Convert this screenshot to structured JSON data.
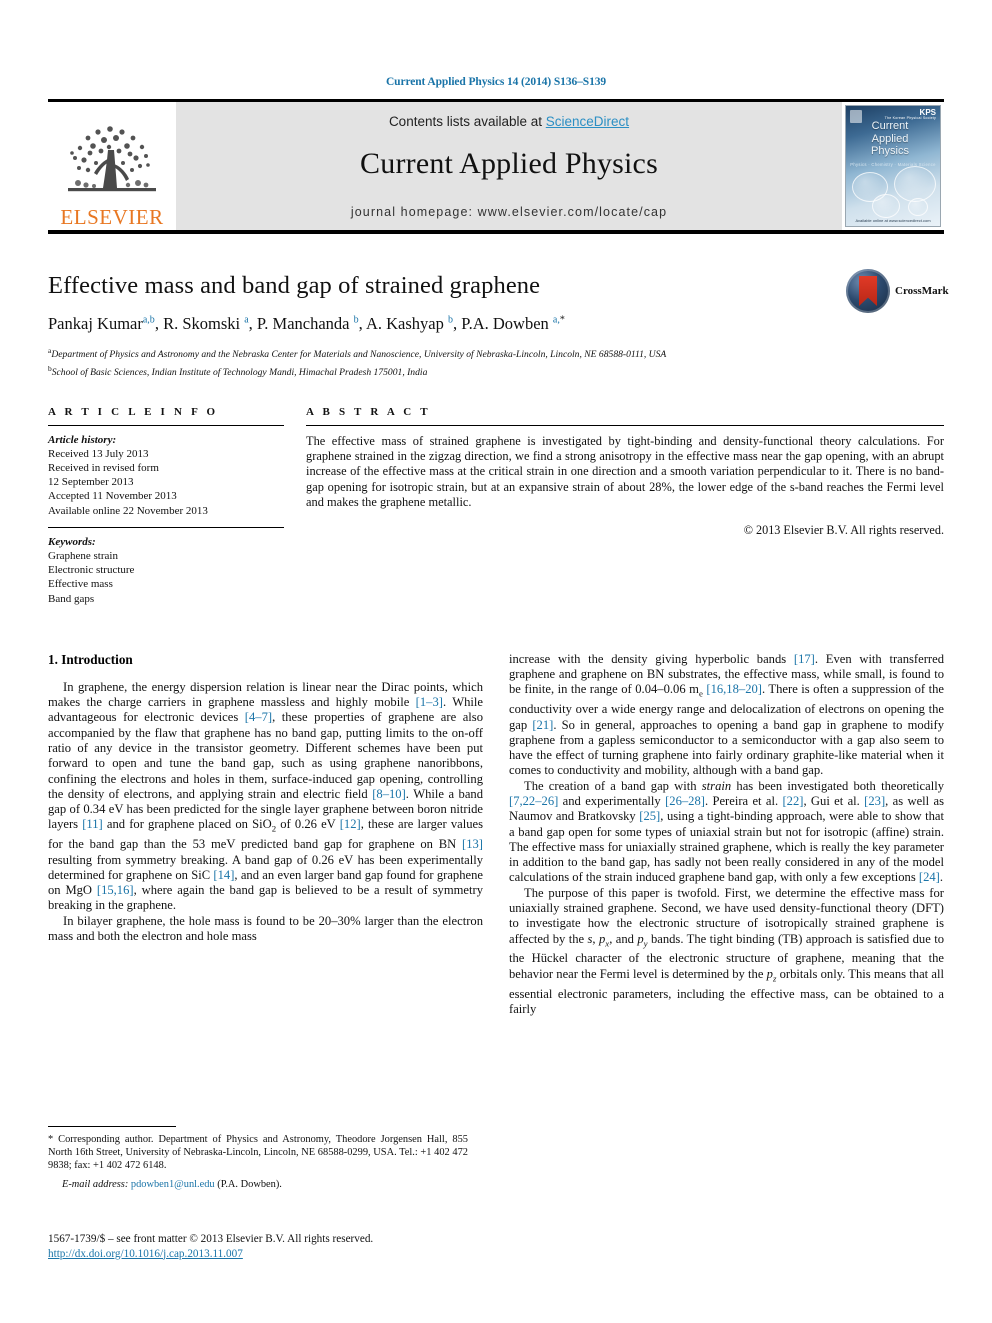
{
  "running_head": "Current Applied Physics 14 (2014) S136–S139",
  "masthead": {
    "publisher_name": "ELSEVIER",
    "contents_prefix": "Contents lists available at ",
    "sciencedirect": "ScienceDirect",
    "journal_title": "Current Applied Physics",
    "homepage": "journal homepage: www.elsevier.com/locate/cap",
    "cover": {
      "title_line1": "Current",
      "title_line2": "Applied",
      "title_line3": "Physics",
      "subtitle": "Physics · Chemistry · Materials Science",
      "kps": "KPS",
      "kps_sub": "The Korean Physical Society",
      "footer": "Available online at www.sciencedirect.com"
    },
    "link_color": "#2b8fc4"
  },
  "article": {
    "title": "Effective mass and band gap of strained graphene",
    "authors_html": "Pankaj Kumar<sup>a,b</sup>, R. Skomski <sup>a</sup>, P. Manchanda <sup>b</sup>, A. Kashyap <sup>b</sup>, P.A. Dowben <sup>a,</sup><sup class=\"star\">*</sup>",
    "affiliation_a": "Department of Physics and Astronomy and the Nebraska Center for Materials and Nanoscience, University of Nebraska-Lincoln, Lincoln, NE 68588-0111, USA",
    "affiliation_b": "School of Basic Sciences, Indian Institute of Technology Mandi, Himachal Pradesh 175001, India",
    "crossmark_label": "CrossMark"
  },
  "article_info": {
    "heading": "A R T I C L E   I N F O",
    "history_label": "Article history:",
    "history": [
      "Received 13 July 2013",
      "Received in revised form",
      "12 September 2013",
      "Accepted 11 November 2013",
      "Available online 22 November 2013"
    ],
    "keywords_label": "Keywords:",
    "keywords": [
      "Graphene strain",
      "Electronic structure",
      "Effective mass",
      "Band gaps"
    ]
  },
  "abstract": {
    "heading": "A B S T R A C T",
    "text": "The effective mass of strained graphene is investigated by tight-binding and density-functional theory calculations. For graphene strained in the zigzag direction, we find a strong anisotropy in the effective mass near the gap opening, with an abrupt increase of the effective mass at the critical strain in one direction and a smooth variation perpendicular to it. There is no band-gap opening for isotropic strain, but at an expansive strain of about 28%, the lower edge of the s-band reaches the Fermi level and makes the graphene metallic.",
    "copyright": "© 2013 Elsevier B.V. All rights reserved."
  },
  "body": {
    "section_title": "1. Introduction",
    "left_paragraphs": [
      "In graphene, the energy dispersion relation is linear near the Dirac points, which makes the charge carriers in graphene massless and highly mobile <a class=\"ref\" href=\"#\">[1–3]</a>. While advantageous for electronic devices <a class=\"ref\" href=\"#\">[4–7]</a>, these properties of graphene are also accompanied by the flaw that graphene has no band gap, putting limits to the on-off ratio of any device in the transistor geometry. Different schemes have been put forward to open and tune the band gap, such as using graphene nanoribbons, confining the electrons and holes in them, surface-induced gap opening, controlling the density of electrons, and applying strain and electric field <a class=\"ref\" href=\"#\">[8–10]</a>. While a band gap of 0.34 eV has been predicted for the single layer graphene between boron nitride layers <a class=\"ref\" href=\"#\">[11]</a> and for graphene placed on SiO<sub>2</sub> of 0.26 eV <a class=\"ref\" href=\"#\">[12]</a>, these are larger values for the band gap than the 53 meV predicted band gap for graphene on BN <a class=\"ref\" href=\"#\">[13]</a> resulting from symmetry breaking. A band gap of 0.26 eV has been experimentally determined for graphene on SiC <a class=\"ref\" href=\"#\">[14]</a>, and an even larger band gap found for graphene on MgO <a class=\"ref\" href=\"#\">[15,16]</a>, where again the band gap is believed to be a result of symmetry breaking in the graphene.",
      "In bilayer graphene, the hole mass is found to be 20–30% larger than the electron mass and both the electron and hole mass"
    ],
    "right_paragraphs": [
      "increase with the density giving hyperbolic bands <a class=\"ref\" href=\"#\">[17]</a>. Even with transferred graphene and graphene on BN substrates, the effective mass, while small, is found to be finite, in the range of 0.04–0.06 m<sub>e</sub> <a class=\"ref\" href=\"#\">[16,18–20]</a>. There is often a suppression of the conductivity over a wide energy range and delocalization of electrons on opening the gap <a class=\"ref\" href=\"#\">[21]</a>. So in general, approaches to opening a band gap in graphene to modify graphene from a gapless semiconductor to a semiconductor with a gap also seem to have the effect of turning graphene into fairly ordinary graphite-like material when it comes to conductivity and mobility, although with a band gap.",
      "The creation of a band gap with <i class=\"mi\">strain</i> has been investigated both theoretically <a class=\"ref\" href=\"#\">[7,22–26]</a> and experimentally <a class=\"ref\" href=\"#\">[26–28]</a>. Pereira et al. <a class=\"ref\" href=\"#\">[22]</a>, Gui et al. <a class=\"ref\" href=\"#\">[23]</a>, as well as Naumov and Bratkovsky <a class=\"ref\" href=\"#\">[25]</a>, using a tight-binding approach, were able to show that a band gap open for some types of uniaxial strain but not for isotropic (affine) strain. The effective mass for uniaxially strained graphene, which is really the key parameter in addition to the band gap, has sadly not been really considered in any of the model calculations of the strain induced graphene band gap, with only a few exceptions <a class=\"ref\" href=\"#\">[24]</a>.",
      "The purpose of this paper is twofold. First, we determine the effective mass for uniaxially strained graphene. Second, we have used density-functional theory (DFT) to investigate how the electronic structure of isotropically strained graphene is affected by the <i class=\"mi\">s</i>, <i class=\"mi\">p<sub>x</sub></i>, and <i class=\"mi\">p<sub>y</sub></i> bands. The tight binding (TB) approach is satisfied due to the Hückel character of the electronic structure of graphene, meaning that the behavior near the Fermi level is determined by the <i class=\"mi\">p<sub>z</sub></i> orbitals only. This means that all essential electronic parameters, including the effective mass, can be obtained to a fairly"
    ]
  },
  "footnote": {
    "corresponding": "* Corresponding author. Department of Physics and Astronomy, Theodore Jorgensen Hall, 855 North 16th Street, University of Nebraska-Lincoln, Lincoln, NE 68588-0299, USA. Tel.: +1 402 472 9838; fax: +1 402 472 6148.",
    "email_label": "E-mail address:",
    "email": "pdowben1@unl.edu",
    "email_owner": "(P.A. Dowben)."
  },
  "bottom": {
    "issn_line": "1567-1739/$ – see front matter © 2013 Elsevier B.V. All rights reserved.",
    "doi": "http://dx.doi.org/10.1016/j.cap.2013.11.007"
  }
}
